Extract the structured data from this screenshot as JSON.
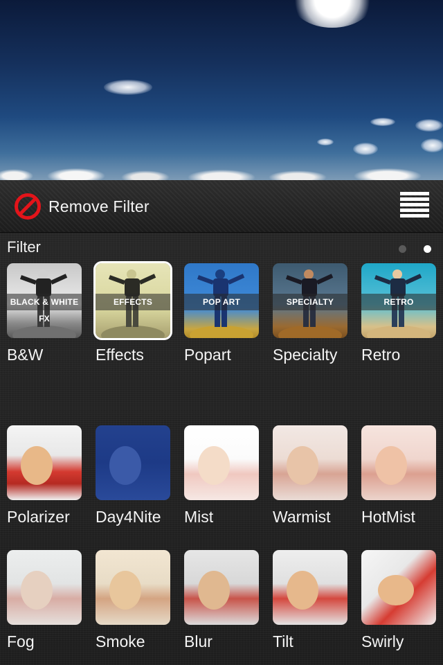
{
  "toolbar": {
    "remove_filter_label": "Remove Filter",
    "remove_icon": "no-entry-icon",
    "menu_icon": "list-menu-icon"
  },
  "panel": {
    "title": "Filter",
    "page_count": 2,
    "active_page": 2
  },
  "categories": [
    {
      "label": "B&W",
      "band": "BLACK & WHITE FX",
      "selected": false
    },
    {
      "label": "Effects",
      "band": "EFFECTS",
      "selected": true
    },
    {
      "label": "Popart",
      "band": "POP ART",
      "selected": false
    },
    {
      "label": "Specialty",
      "band": "SPECIALTY",
      "selected": false
    },
    {
      "label": "Retro",
      "band": "RETRO",
      "selected": false
    }
  ],
  "filters_row1": [
    {
      "label": "Polarizer"
    },
    {
      "label": "Day4Nite"
    },
    {
      "label": "Mist"
    },
    {
      "label": "Warmist"
    },
    {
      "label": "HotMist"
    }
  ],
  "filters_row2": [
    {
      "label": "Fog"
    },
    {
      "label": "Smoke"
    },
    {
      "label": "Blur"
    },
    {
      "label": "Tilt"
    },
    {
      "label": "Swirly"
    }
  ],
  "colors": {
    "accent_red": "#e3141a",
    "selected_border": "#ffffff",
    "inactive_dot": "#5a5a5a"
  }
}
